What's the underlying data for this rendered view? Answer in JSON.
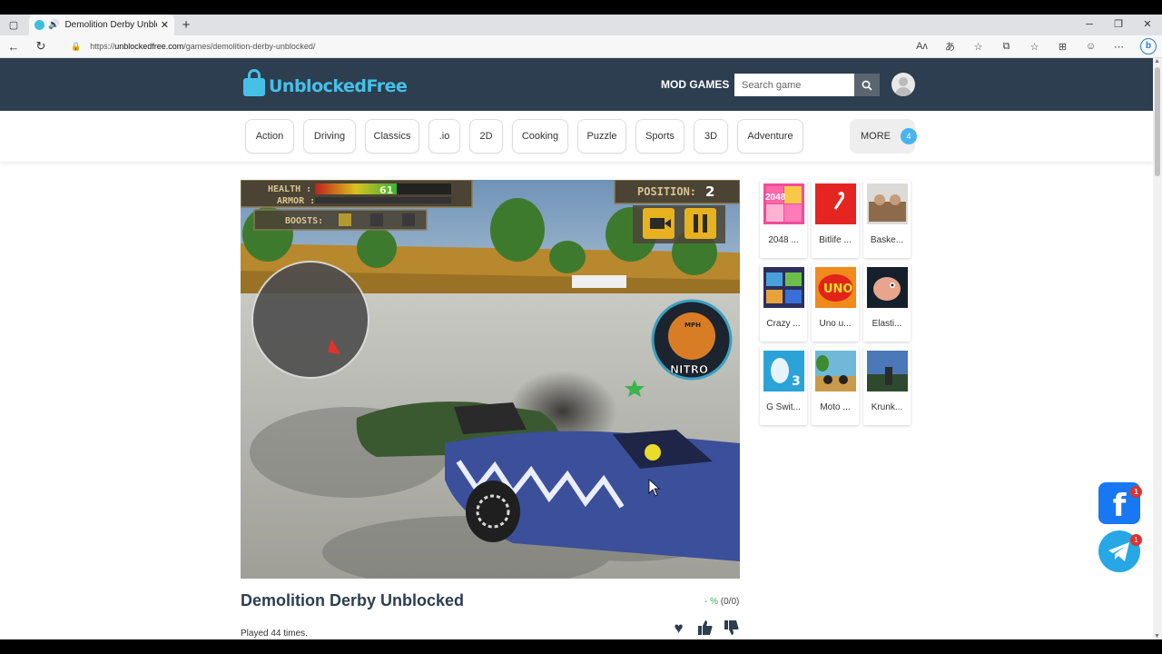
{
  "browser": {
    "tab_title": "Demolition Derby Unblocke",
    "url_prefix": "https://",
    "url_host": "unblockedfree.com",
    "url_path": "/games/demolition-derby-unblocked/"
  },
  "site": {
    "logo_text": "UnblockedFree",
    "mod_games": "MOD GAMES",
    "search_placeholder": "Search game"
  },
  "categories": [
    "Action",
    "Driving",
    "Classics",
    ".io",
    "2D",
    "Cooking",
    "Puzzle",
    "Sports",
    "3D",
    "Adventure"
  ],
  "more": {
    "label": "MORE",
    "badge": "4"
  },
  "game_hud": {
    "health_label": "HEALTH :",
    "armor_label": "ARMOR :",
    "health_value": "61",
    "health_level": 0.6,
    "boosts_label": "BOOSTS:",
    "position_label": "POSITION:",
    "position_value": "2",
    "mph_label": "MPH",
    "nitro_label": "NITRO"
  },
  "sidebar_games": [
    {
      "label": "2048 ...",
      "thumb": "2048"
    },
    {
      "label": "Bitlife ...",
      "thumb": "bitlife"
    },
    {
      "label": "Baske...",
      "thumb": "basket"
    },
    {
      "label": "Crazy ...",
      "thumb": "crazy"
    },
    {
      "label": "Uno u...",
      "thumb": "uno"
    },
    {
      "label": "Elasti...",
      "thumb": "elastic"
    },
    {
      "label": "G Swit...",
      "thumb": "gswitch"
    },
    {
      "label": "Moto ...",
      "thumb": "moto"
    },
    {
      "label": "Krunk...",
      "thumb": "krunker"
    }
  ],
  "game_info": {
    "title": "Demolition Derby Unblocked",
    "rating_pct": "- %",
    "rating_count": "(0/0)",
    "played": "Played 44 times."
  },
  "social": {
    "facebook_badge": "1",
    "telegram_badge": "1"
  },
  "colors": {
    "header_bg": "#2c3e50",
    "accent": "#47c0e8",
    "badge": "#47b4f0"
  }
}
